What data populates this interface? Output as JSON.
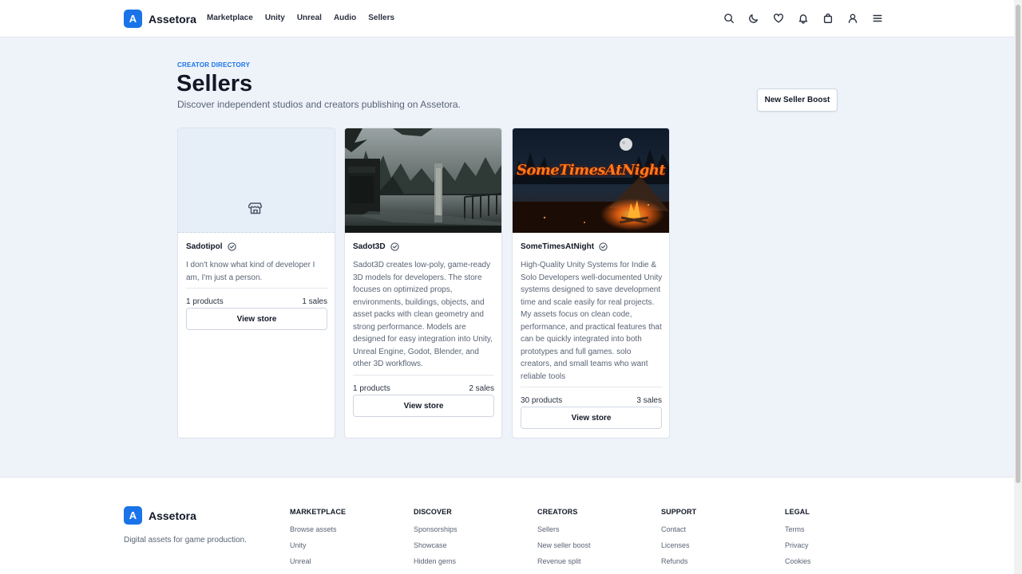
{
  "brand": {
    "mark": "A",
    "name": "Assetora",
    "accent": "#1a73e8"
  },
  "nav": {
    "items": [
      "Marketplace",
      "Unity",
      "Unreal",
      "Audio",
      "Sellers"
    ]
  },
  "header_icons": [
    "search-icon",
    "moon-icon",
    "heart-icon",
    "bell-icon",
    "cart-icon",
    "user-icon",
    "menu-icon"
  ],
  "hero": {
    "eyebrow": "CREATOR DIRECTORY",
    "title": "Sellers",
    "subtitle": "Discover independent studios and creators publishing on Assetora.",
    "cta_label": "New Seller Boost"
  },
  "sellers": [
    {
      "name": "Sadotipol",
      "description": "I don't know what kind of developer I am, I'm just a person.",
      "products": "1 products",
      "sales": "1 sales",
      "button": "View store",
      "image": "store-placeholder-icon"
    },
    {
      "name": "Sadot3D",
      "description": "Sadot3D creates low-poly, game-ready 3D models for developers. The store focuses on optimized props, environments, buildings, objects, and asset packs with clean geometry and strong performance. Models are designed for easy integration into Unity, Unreal Engine, Godot, Blender, and other 3D workflows.",
      "products": "1 products",
      "sales": "2 sales",
      "button": "View store",
      "image": "flooded-swamp-scene"
    },
    {
      "name": "SomeTimesAtNight",
      "description": "High-Quality Unity Systems for Indie & Solo Developers well-documented Unity systems designed to save development time and scale easily for real projects. My assets focus on clean code, performance, and practical features that can be quickly integrated into both prototypes and full games. solo creators, and small teams who want reliable tools",
      "products": "30 products",
      "sales": "3 sales",
      "button": "View store",
      "image": "night-campfire-banner",
      "banner_text": "SomeTimesAtNight"
    }
  ],
  "footer": {
    "tagline": "Digital assets for game production.",
    "columns": [
      {
        "title": "MARKETPLACE",
        "links": [
          "Browse assets",
          "Unity",
          "Unreal"
        ]
      },
      {
        "title": "DISCOVER",
        "links": [
          "Sponsorships",
          "Showcase",
          "Hidden gems"
        ]
      },
      {
        "title": "CREATORS",
        "links": [
          "Sellers",
          "New seller boost",
          "Revenue split"
        ]
      },
      {
        "title": "SUPPORT",
        "links": [
          "Contact",
          "Licenses",
          "Refunds"
        ]
      },
      {
        "title": "LEGAL",
        "links": [
          "Terms",
          "Privacy",
          "Cookies"
        ]
      }
    ]
  }
}
